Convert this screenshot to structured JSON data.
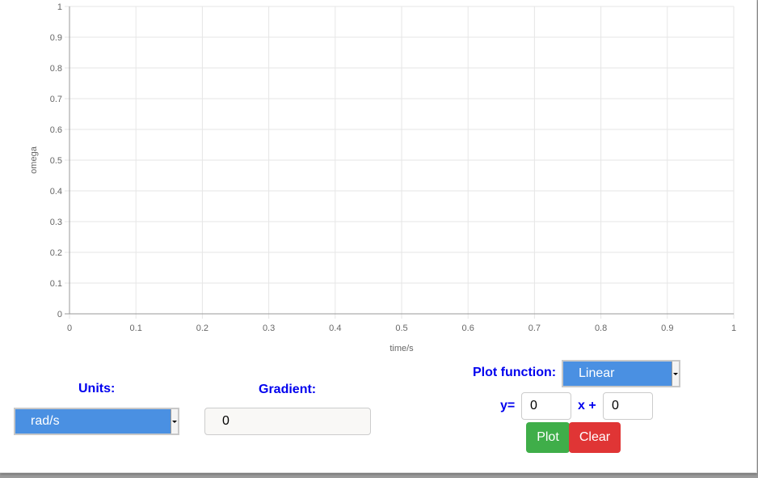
{
  "chart_data": {
    "type": "line",
    "series": [],
    "xlabel": "time/s",
    "ylabel": "omega",
    "xlim": [
      0,
      1
    ],
    "ylim": [
      0,
      1
    ],
    "x_ticks": [
      "0",
      "0.1",
      "0.2",
      "0.3",
      "0.4",
      "0.5",
      "0.6",
      "0.7",
      "0.8",
      "0.9",
      "1"
    ],
    "y_ticks": [
      "0",
      "0.1",
      "0.2",
      "0.3",
      "0.4",
      "0.5",
      "0.6",
      "0.7",
      "0.8",
      "0.9",
      "1"
    ],
    "grid": true,
    "grid_color": "#e6e6e6"
  },
  "controls": {
    "units_label": "Units:",
    "units_value": "rad/s",
    "gradient_label": "Gradient:",
    "gradient_value": "0",
    "plot_function_label": "Plot function:",
    "plot_function_value": "Linear",
    "y_equals_label": "y=",
    "slope_value": "0",
    "x_plus_label": "x +",
    "intercept_value": "0",
    "plot_button": "Plot",
    "clear_button": "Clear"
  },
  "colors": {
    "select_bg": "#4a90e2",
    "label_color": "#0000ee",
    "plot_button": "#3fae49",
    "clear_button": "#e03535"
  },
  "icons": {
    "select_arrow": "chevron-down-icon"
  }
}
